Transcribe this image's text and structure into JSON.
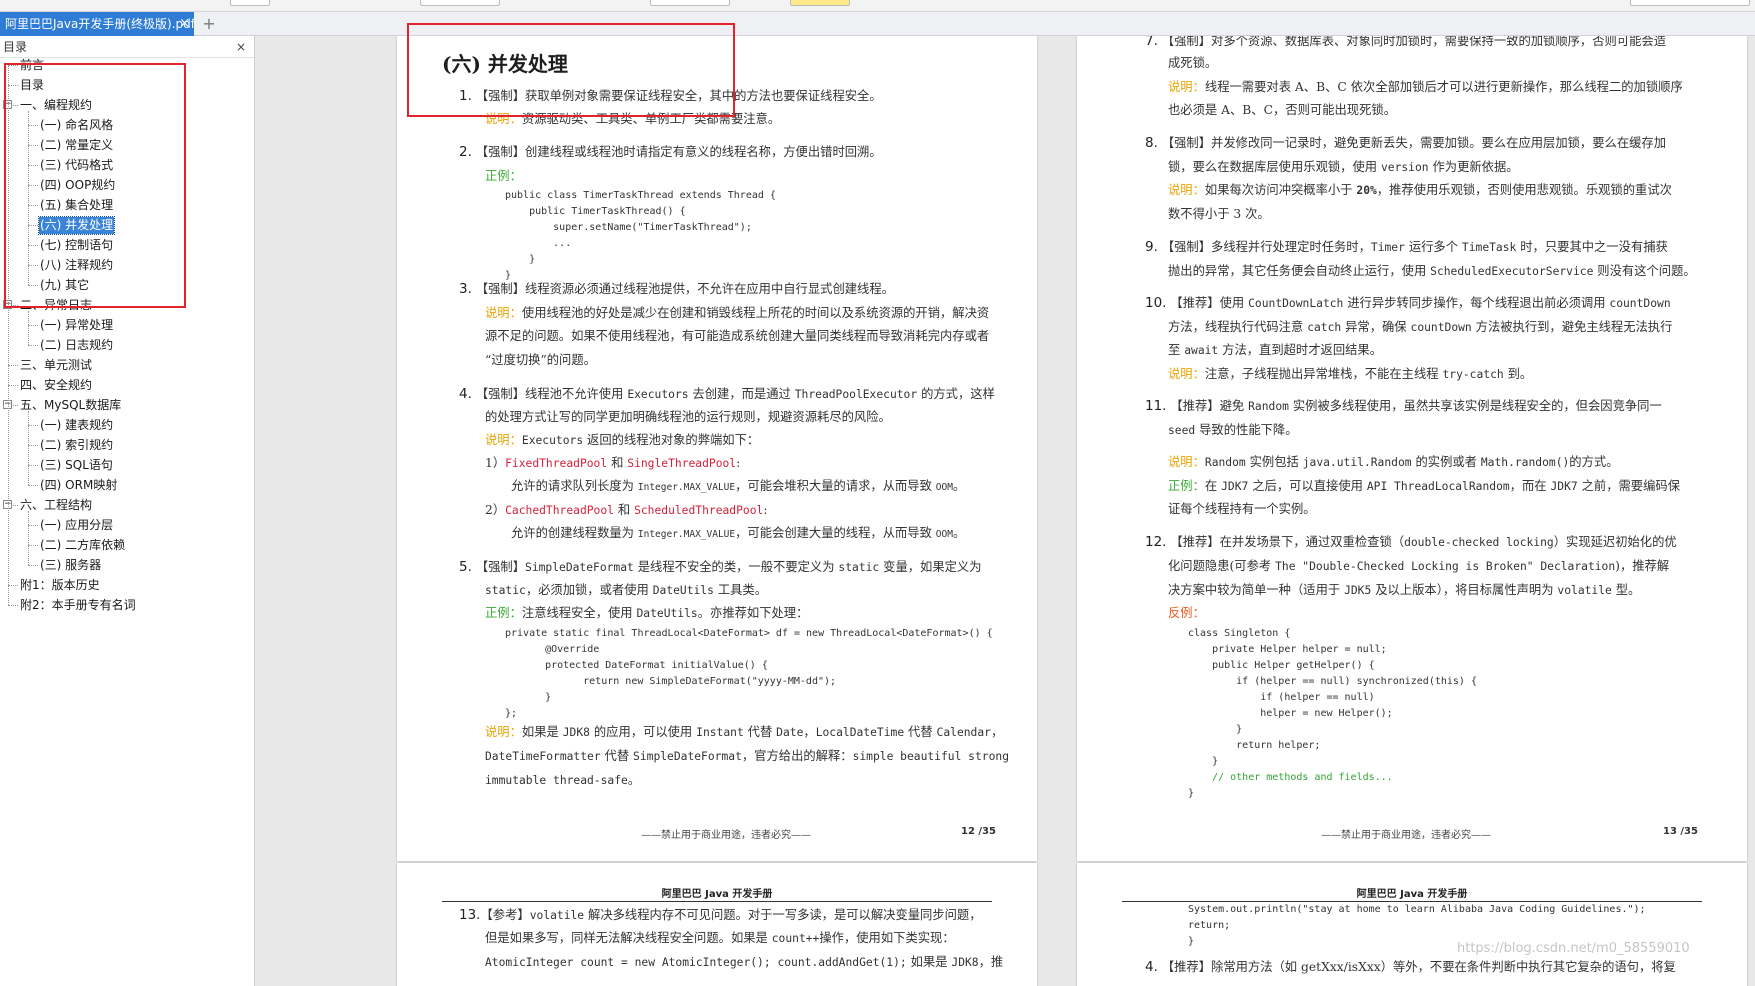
{
  "tab": {
    "title": "阿里巴巴Java开发手册(终极版).pdf",
    "close": "×",
    "add": "+"
  },
  "sidebar": {
    "title": "目录",
    "close": "×",
    "items": [
      "前言",
      "目录",
      "一、编程规约",
      "(一) 命名风格",
      "(二) 常量定义",
      "(三) 代码格式",
      "(四) OOP规约",
      "(五) 集合处理",
      "(六) 并发处理",
      "(七) 控制语句",
      "(八) 注释规约",
      "(九) 其它",
      "二、异常日志",
      "(一) 异常处理",
      "(二) 日志规约",
      "三、单元测试",
      "四、安全规约",
      "五、MySQL数据库",
      "(一) 建表规约",
      "(二) 索引规约",
      "(三) SQL语句",
      "(四) ORM映射",
      "六、工程结构",
      "(一) 应用分层",
      "(二) 二方库依赖",
      "(三) 服务器",
      "附1：版本历史",
      "附2：本手册专有名词"
    ],
    "toggle_minus": "−"
  },
  "page12": {
    "section_title": "(六) 并发处理",
    "r1": {
      "num": "1.",
      "tag": "【强制】",
      "text": "获取单例对象需要保证线程安全，其中的方法也要保证线程安全。",
      "note_label": "说明：",
      "note": "资源驱动类、工具类、单例工厂类都需要注意。"
    },
    "r2": {
      "num": "2.",
      "tag": "【强制】",
      "text": "创建线程或线程池时请指定有意义的线程名称，方便出错时回溯。",
      "good_label": "正例："
    },
    "r2_code": [
      "public class TimerTaskThread extends Thread {",
      "    public TimerTaskThread() {",
      "        super.setName(\"TimerTaskThread\");",
      "        ...",
      "    }"
    ],
    "r3": {
      "num": "3.",
      "tag": "【强制】",
      "text": "线程资源必须通过线程池提供，不允许在应用中自行显式创建线程。",
      "note_label": "说明：",
      "note1": "使用线程池的好处是减少在创建和销毁线程上所花的时间以及系统资源的开销，解决资",
      "note2": "源不足的问题。如果不使用线程池，有可能造成系统创建大量同类线程而导致消耗完内存或者",
      "note3": "“过度切换”的问题。"
    },
    "r4": {
      "num": "4.",
      "tag": "【强制】",
      "text1": "线程池不允许使用 ",
      "c1": "Executors",
      "text2": " 去创建，而是通过 ",
      "c2": "ThreadPoolExecutor",
      "text3": " 的方式，这样",
      "text4": "的处理方式让写的同学更加明确线程池的运行规则，规避资源耗尽的风险。",
      "note_label": "说明：",
      "c3": "Executors",
      "note": " 返回的线程池对象的弊端如下：",
      "s1_num": "1）",
      "s1_a": "FixedThreadPool",
      "s1_and": " 和 ",
      "s1_b": "SingleThreadPool",
      "s1_colon": ":",
      "s1_t1": "允许的请求队列长度为 ",
      "s1_c": "Integer.MAX_VALUE",
      "s1_t2": "，可能会堆积大量的请求，从而导致 ",
      "s1_oom": "OOM",
      "s1_end": "。",
      "s2_num": "2）",
      "s2_a": "CachedThreadPool",
      "s2_and": " 和 ",
      "s2_b": "ScheduledThreadPool",
      "s2_colon": ":",
      "s2_t1": "允许的创建线程数量为 ",
      "s2_c": "Integer.MAX_VALUE",
      "s2_t2": "，可能会创建大量的线程，从而导致 ",
      "s2_oom": "OOM",
      "s2_end": "。"
    },
    "r5": {
      "num": "5.",
      "tag": "【强制】",
      "c1": "SimpleDateFormat",
      "t1": " 是线程不安全的类，一般不要定义为 ",
      "c2": "static",
      "t2": " 变量，如果定义为",
      "c3": "static",
      "t3": "，必须加锁，或者使用 ",
      "c4": "DateUtils",
      "t4": " 工具类。",
      "good_label": "正例：",
      "good_t": "注意线程安全，使用 ",
      "good_c": "DateUtils",
      "good_t2": "。亦推荐如下处理：",
      "note_label": "说明：",
      "n1": "如果是 ",
      "n_jdk": "JDK8",
      "n2": " 的应用，可以使用 ",
      "n_c1": "Instant",
      "n3": " 代替 ",
      "n_c2": "Date",
      "n4": "，",
      "n_c3": "LocalDateTime",
      "n5": " 代替 ",
      "n_c4": "Calendar",
      "n6": "，",
      "n_c5": "DateTimeFormatter",
      "n7": " 代替 ",
      "n_c6": "SimpleDateFormat",
      "n8": "，官方给出的解释：",
      "n_c7": "simple beautiful strong",
      "n_c8": "immutable thread-safe",
      "n9": "。"
    },
    "r5_code": [
      "private static final ThreadLocal<DateFormat> df = new ThreadLocal<DateFormat>() {",
      "    @Override",
      "    protected DateFormat initialValue() {",
      "        return new SimpleDateFormat(\"yyyy-MM-dd\");",
      "    }",
      "};"
    ],
    "r2_code_end": "}",
    "footer": "——禁止用于商业用途，违者必究——",
    "page_num": "12 /35"
  },
  "page13": {
    "r7a": {
      "num": "7.",
      "tag": "【强制】",
      "text": "对多个资源、数据库表、对象同时加锁时，需要保持一致的加锁顺序，否则可能会造",
      "text2": "成死锁。",
      "note_label": "说明：",
      "note1": "线程一需要对表 A、B、C 依次全部加锁后才可以进行更新操作，那么线程二的加锁顺序",
      "note2": "也必须是 A、B、C，否则可能出现死锁。"
    },
    "r8": {
      "num": "8.",
      "tag": "【强制】",
      "t1": "并发修改同一记录时，避免更新丢失，需要加锁。要么在应用层加锁，要么在缓存加",
      "t2": "锁，要么在数据库层使用乐观锁，使用 ",
      "c1": "version",
      "t3": " 作为更新依据。",
      "note_label": "说明：",
      "n1": "如果每次访问冲突概率小于 ",
      "n_b": "20%",
      "n2": "，推荐使用乐观锁，否则使用悲观锁。乐观锁的重试次",
      "n3": "数不得小于 3 次。"
    },
    "r9": {
      "num": "9.",
      "tag": "【强制】",
      "t1": "多线程并行处理定时任务时，",
      "c1": "Timer",
      "t2": " 运行多个 ",
      "c2": "TimeTask",
      "t3": " 时，只要其中之一没有捕获",
      "t4": "抛出的异常，其它任务便会自动终止运行，使用 ",
      "c3": "ScheduledExecutorService",
      "t5": " 则没有这个问题。"
    },
    "r10": {
      "num": "10.",
      "tag": "【推荐】",
      "t1": "使用 ",
      "c1": "CountDownLatch",
      "t2": " 进行异步转同步操作，每个线程退出前必须调用 ",
      "c2": "countDown",
      "t3": "方法，线程执行代码注意 ",
      "c3": "catch",
      "t4": " 异常，确保 ",
      "c4": "countDown",
      "t5": " 方法被执行到，避免主线程无法执行",
      "t6": "至 ",
      "c5": "await",
      "t7": " 方法，直到超时才返回结果。",
      "note_label": "说明：",
      "n1": "注意，子线程抛出异常堆栈，不能在主线程 ",
      "n_c": "try-catch",
      "n2": " 到。"
    },
    "r11": {
      "num": "11.",
      "tag": "【推荐】",
      "t1": "避免 ",
      "c1": "Random",
      "t2": " 实例被多线程使用，虽然共享该实例是线程安全的，但会因竞争同一",
      "c2": "seed",
      "t3": " 导致的性能下降。",
      "note_label": "说明：",
      "n_c1": "Random",
      "n1": " 实例包括 ",
      "n_c2": "java.util.Random",
      "n2": " 的实例或者 ",
      "n_c3": "Math.random()",
      "n3": "的方式。",
      "good_label": "正例：",
      "g1": "在 ",
      "g_jdk": "JDK7",
      "g2": " 之后，可以直接使用 ",
      "g_api": "API ThreadLocalRandom",
      "g3": "，而在 ",
      "g_jdk2": "JDK7",
      "g4": " 之前，需要编码保",
      "g5": "证每个线程持有一个实例。"
    },
    "r12": {
      "num": "12.",
      "tag": "【推荐】",
      "t1": "在并发场景下，通过双重检查锁（",
      "c1": "double-checked locking",
      "t2": "）实现延迟初始化的优",
      "t3": "化问题隐患(可参考 ",
      "c2": "The \"Double-Checked Locking is Broken\" Declaration",
      "t4": ")，推荐解",
      "t5": "决方案中较为简单一种（适用于 ",
      "c3": "JDK5",
      "t6": " 及以上版本），将目标属性声明为 ",
      "c4": "volatile",
      "t7": " 型。",
      "bad_label": "反例："
    },
    "r12_code": [
      "class Singleton {",
      "    private Helper helper = null;",
      "    public Helper getHelper() {",
      "        if (helper == null) synchronized(this) {",
      "            if (helper == null)",
      "            helper = new Helper();",
      "        }",
      "        return helper;",
      "    }",
      "    // other methods and fields...",
      "}"
    ],
    "footer": "——禁止用于商业用途，违者必究——",
    "page_num": "13 /35"
  },
  "page14": {
    "header": "阿里巴巴 Java 开发手册",
    "r13": {
      "num": "13.",
      "tag": "【参考】",
      "c1": "volatile",
      "t1": " 解决多线程内存不可见问题。对于一写多读，是可以解决变量同步问题，",
      "t2": "但是如果多写，同样无法解决线程安全问题。如果是 ",
      "c2": "count++",
      "t3": "操作，使用如下类实现：",
      "c3": "AtomicInteger count = new AtomicInteger(); count.addAndGet(1);",
      "t4": " 如果是 ",
      "c4": "JDK8",
      "t5": "，推"
    }
  },
  "page15": {
    "header": "阿里巴巴 Java 开发手册",
    "code": [
      "System.out.println(\"stay at home to learn Alibaba Java Coding Guidelines.\");",
      "return;",
      "}"
    ],
    "r4": {
      "num": "4.",
      "tag": "【推荐】",
      "t1": "除常用方法（如 getXxx/isXxx）等外，不要在条件判断中执行其它复杂的语句，将复"
    },
    "watermark": "https://blog.csdn.net/m0_58559010"
  },
  "colors": {
    "tab": "#2e7cd6",
    "selection": "#3a84d8",
    "highlight_box": "#e1232b",
    "note": "#e8a300",
    "good": "#3aaa35",
    "bad": "#ea5f24",
    "red_code": "#d4213a"
  }
}
